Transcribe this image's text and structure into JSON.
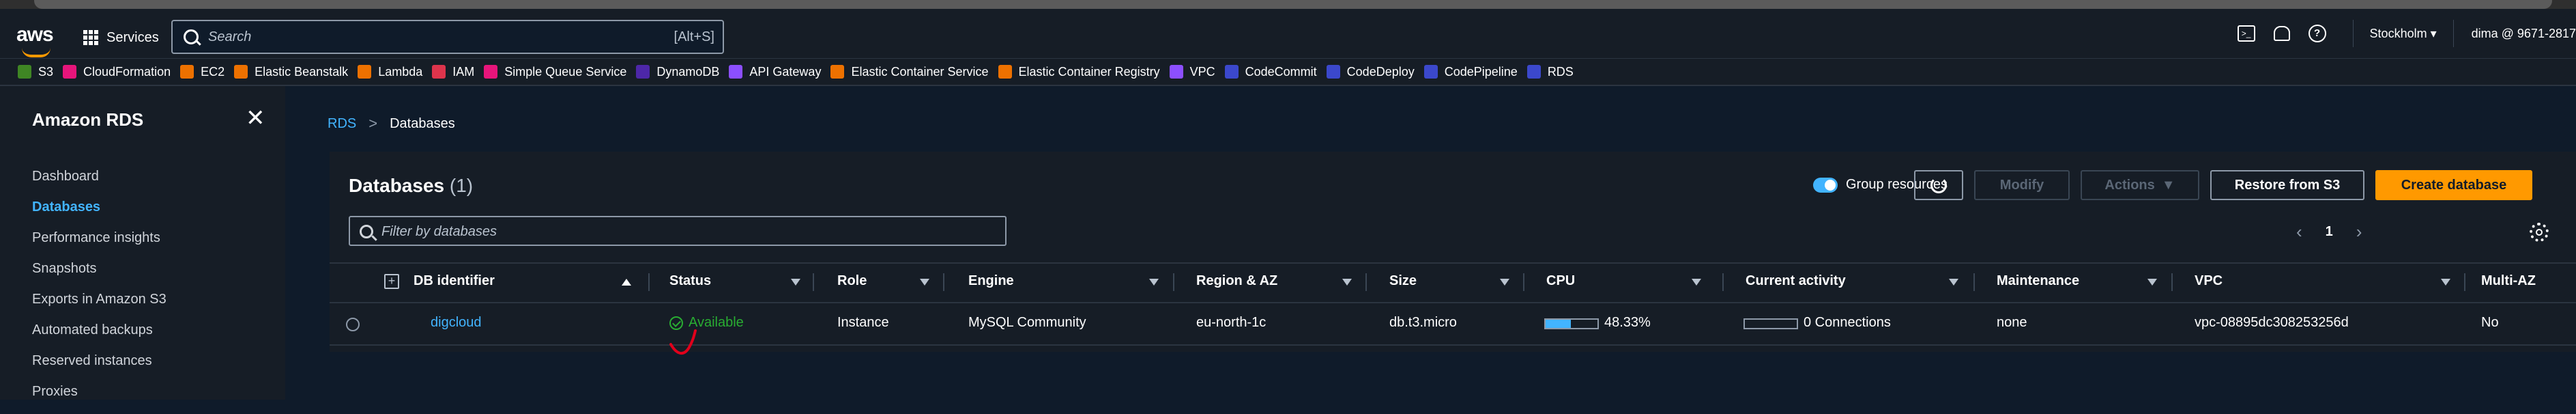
{
  "header": {
    "logo": "aws",
    "services_label": "Services",
    "search_placeholder": "Search",
    "search_shortcut": "[Alt+S]",
    "region": "Stockholm ▾",
    "account": "dima @ 9671-2817"
  },
  "favorites": [
    {
      "label": "S3",
      "color": "#3f8624"
    },
    {
      "label": "CloudFormation",
      "color": "#e7157b"
    },
    {
      "label": "EC2",
      "color": "#ed7100"
    },
    {
      "label": "Elastic Beanstalk",
      "color": "#ed7100"
    },
    {
      "label": "Lambda",
      "color": "#ed7100"
    },
    {
      "label": "IAM",
      "color": "#dd344c"
    },
    {
      "label": "Simple Queue Service",
      "color": "#e7157b"
    },
    {
      "label": "DynamoDB",
      "color": "#4d27a8"
    },
    {
      "label": "API Gateway",
      "color": "#8c4fff"
    },
    {
      "label": "Elastic Container Service",
      "color": "#ed7100"
    },
    {
      "label": "Elastic Container Registry",
      "color": "#ed7100"
    },
    {
      "label": "VPC",
      "color": "#8c4fff"
    },
    {
      "label": "CodeCommit",
      "color": "#3b48cc"
    },
    {
      "label": "CodeDeploy",
      "color": "#3b48cc"
    },
    {
      "label": "CodePipeline",
      "color": "#3b48cc"
    },
    {
      "label": "RDS",
      "color": "#3b48cc"
    }
  ],
  "sidebar": {
    "title": "Amazon RDS",
    "items": [
      {
        "label": "Dashboard",
        "active": false
      },
      {
        "label": "Databases",
        "active": true
      },
      {
        "label": "Performance insights",
        "active": false
      },
      {
        "label": "Snapshots",
        "active": false
      },
      {
        "label": "Exports in Amazon S3",
        "active": false
      },
      {
        "label": "Automated backups",
        "active": false
      },
      {
        "label": "Reserved instances",
        "active": false
      },
      {
        "label": "Proxies",
        "active": false
      }
    ]
  },
  "breadcrumb": {
    "root": "RDS",
    "separator": ">",
    "current": "Databases"
  },
  "panel": {
    "title": "Databases",
    "count": "(1)",
    "group_label": "Group resources",
    "group_enabled": true,
    "modify_label": "Modify",
    "actions_label": "Actions",
    "restore_label": "Restore from S3",
    "create_label": "Create database",
    "filter_placeholder": "Filter by databases",
    "page": "1",
    "prev": "‹",
    "next": "›"
  },
  "columns": [
    "DB identifier",
    "Status",
    "Role",
    "Engine",
    "Region & AZ",
    "Size",
    "CPU",
    "Current activity",
    "Maintenance",
    "VPC",
    "Multi-AZ"
  ],
  "rows": [
    {
      "db_identifier": "digcloud",
      "status": "Available",
      "role": "Instance",
      "engine": "MySQL Community",
      "region_az": "eu-north-1c",
      "size": "db.t3.micro",
      "cpu": "48.33%",
      "cpu_fraction": 0.4833,
      "activity": "0 Connections",
      "maintenance": "none",
      "vpc": "vpc-08895dc308253256d",
      "multi_az": "No"
    }
  ],
  "colors": {
    "accent": "#42b4ff",
    "primary_button": "#ff9900",
    "status_ok": "#29ad32",
    "annotation": "#e0001b"
  }
}
